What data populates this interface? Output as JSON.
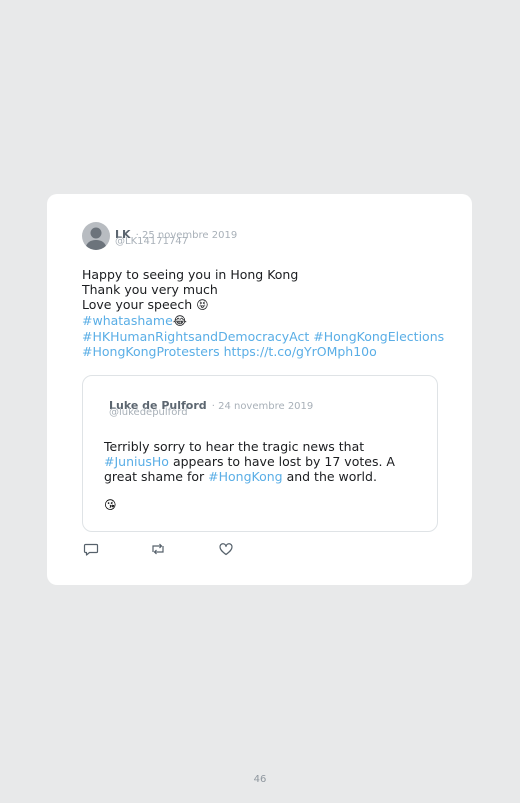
{
  "tweet": {
    "author_name": "LK",
    "date": "· 25 novembre 2019",
    "handle": "@LK14171747",
    "lines": {
      "l1": "Happy to seeing you in Hong Kong",
      "l2": "Thank you very much",
      "l3_text": "Love your speech ",
      "l3_emoji": "😝",
      "l4_hashtag": "#whatashame",
      "l4_emoji": "😂",
      "l5_hashtag1": "#HKHumanRightsandDemocracyAct",
      "l5_hashtag2": "#HongKongElections",
      "l6_hashtag": "#HongKongProtesters",
      "l6_link": "https://t.co/gYrOMph10o"
    }
  },
  "quoted_tweet": {
    "author_name": "Luke de Pulford",
    "date": "· 24 novembre 2019",
    "handle": "@lukedepulford",
    "text_part1": "Terribly sorry to hear the tragic news that ",
    "hashtag1": "#JuniusHo",
    "text_part2": " appears to have lost by 17 votes. A great shame for ",
    "hashtag2": "#HongKong",
    "text_part3": " and the world.",
    "emoji": "😘"
  },
  "actions": {
    "reply_icon": "reply-icon",
    "retweet_icon": "retweet-icon",
    "like_icon": "heart-icon"
  },
  "page_number": "46"
}
